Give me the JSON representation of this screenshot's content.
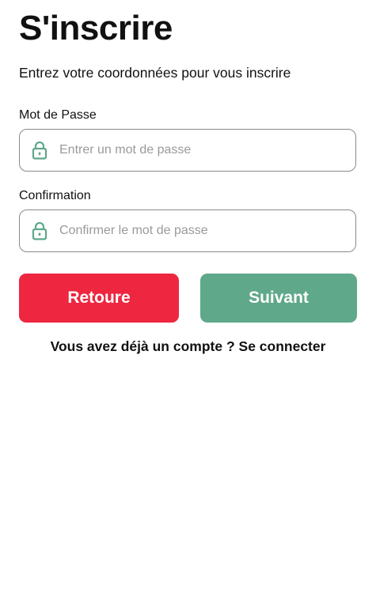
{
  "page": {
    "title": "S'inscrire",
    "subtitle": "Entrez votre coordonnées pour vous inscrire"
  },
  "form": {
    "password": {
      "label": "Mot de Passe",
      "placeholder": "Entrer un mot de passe",
      "value": "",
      "icon": "lock-icon"
    },
    "confirmation": {
      "label": "Confirmation",
      "placeholder": "Confirmer le mot de passe",
      "value": "",
      "icon": "lock-icon"
    }
  },
  "buttons": {
    "back_label": "Retoure",
    "next_label": "Suivant"
  },
  "login": {
    "prompt": "Vous avez déjà un compte ? ",
    "link_label": "Se connecter"
  },
  "colors": {
    "back_button": "#ee2640",
    "next_button": "#5fa88a",
    "lock_icon": "#5fa88a"
  }
}
